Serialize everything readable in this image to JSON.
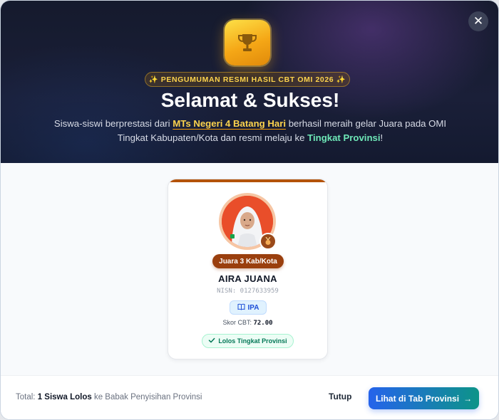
{
  "modal": {
    "close_glyph": "✕",
    "announcement": "✨ PENGUMUMAN RESMI HASIL CBT OMI 2026 ✨",
    "title": "Selamat & Sukses!",
    "subtitle": {
      "part1": "Siswa-siswi berprestasi dari ",
      "school": "MTs Negeri 4 Batang Hari",
      "part2": " berhasil meraih gelar Juara pada OMI Tingkat Kabupaten/Kota dan resmi melaju ke ",
      "province": "Tingkat Provinsi",
      "part3": "!"
    }
  },
  "student_card": {
    "rank": "Juara 3 Kab/Kota",
    "name": "AIRA JUANA",
    "nisn": "NISN: 0127633959",
    "subject": "IPA",
    "score_label": "Skor CBT: ",
    "score_value": "72.00",
    "status": "Lolos Tingkat Provinsi"
  },
  "footer": {
    "total_prefix": "Total: ",
    "total_count": "1 Siswa Lolos",
    "total_suffix": " ke Babak Penyisihan Provinsi",
    "close_label": "Tutup",
    "primary_label": "Lihat di Tab Provinsi",
    "primary_arrow": "→"
  },
  "colors": {
    "hero_bg": "#151a2d",
    "gold": "#fcd34d",
    "green": "#6ee7b7",
    "rank_badge": "#9a3f0e",
    "accent_bar": "#b45309",
    "button_start": "#2563eb",
    "button_end": "#0d9488"
  },
  "icons": {
    "close": "close-icon",
    "trophy": "trophy-icon",
    "medal": "medal-icon",
    "subject": "book-icon",
    "status": "check-icon"
  }
}
